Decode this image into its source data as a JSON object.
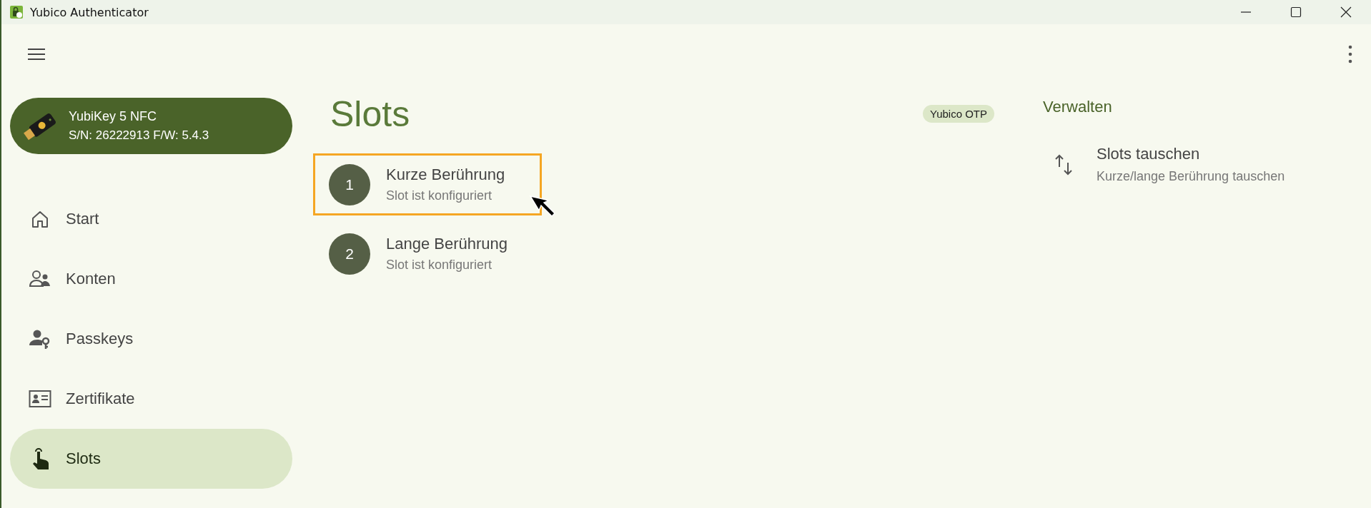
{
  "window": {
    "title": "Yubico Authenticator"
  },
  "device": {
    "name": "YubiKey 5 NFC",
    "info": "S/N: 26222913 F/W: 5.4.3"
  },
  "nav": [
    {
      "kind": "home",
      "label": "Start",
      "selected": false
    },
    {
      "kind": "accounts",
      "label": "Konten",
      "selected": false
    },
    {
      "kind": "passkeys",
      "label": "Passkeys",
      "selected": false
    },
    {
      "kind": "certificates",
      "label": "Zertifikate",
      "selected": false
    },
    {
      "kind": "slots",
      "label": "Slots",
      "selected": true
    }
  ],
  "page": {
    "title": "Slots",
    "badge": "Yubico OTP"
  },
  "slots": [
    {
      "number": "1",
      "title": "Kurze Berührung",
      "subtitle": "Slot ist konfiguriert",
      "highlighted": true
    },
    {
      "number": "2",
      "title": "Lange Berührung",
      "subtitle": "Slot ist konfiguriert",
      "highlighted": false
    }
  ],
  "manage": {
    "heading": "Verwalten",
    "actions": [
      {
        "title": "Slots tauschen",
        "subtitle": "Kurze/lange Berührung tauschen"
      }
    ]
  }
}
